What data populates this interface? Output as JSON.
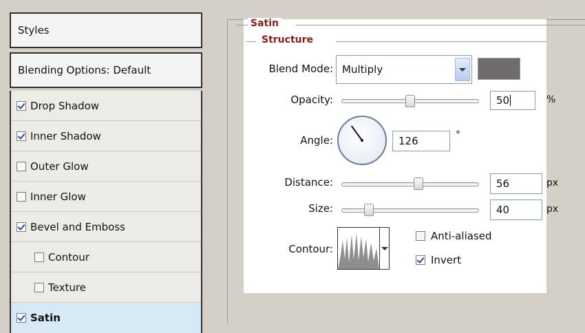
{
  "styles_panel": {
    "header": "Styles",
    "blending_options": "Blending Options: Default",
    "items": [
      {
        "label": "Drop Shadow",
        "checked": true
      },
      {
        "label": "Inner Shadow",
        "checked": true
      },
      {
        "label": "Outer Glow",
        "checked": false
      },
      {
        "label": "Inner Glow",
        "checked": false
      },
      {
        "label": "Bevel and Emboss",
        "checked": true
      },
      {
        "label": "Contour",
        "checked": false
      },
      {
        "label": "Texture",
        "checked": false
      },
      {
        "label": "Satin",
        "checked": true
      }
    ]
  },
  "satin": {
    "section_title": "Satin",
    "group_title": "Structure",
    "blend_mode_label": "Blend Mode:",
    "blend_mode_value": "Multiply",
    "swatch_color": "#706c6c",
    "opacity_label": "Opacity:",
    "opacity_value": "50",
    "opacity_unit": "%",
    "opacity_slider_fraction": 0.5,
    "angle_label": "Angle:",
    "angle_value": "126",
    "angle_unit": "°",
    "distance_label": "Distance:",
    "distance_value": "56",
    "distance_unit": "px",
    "distance_slider_fraction": 0.56,
    "size_label": "Size:",
    "size_value": "40",
    "size_unit": "px",
    "size_slider_fraction": 0.2,
    "contour_label": "Contour:",
    "anti_aliased_label": "Anti-aliased",
    "anti_aliased_checked": false,
    "invert_label": "Invert",
    "invert_checked": true
  },
  "colors": {
    "title_accent": "#8a1c1c",
    "selected_row": "#d8e9f6",
    "field_border": "#7f9db9"
  }
}
